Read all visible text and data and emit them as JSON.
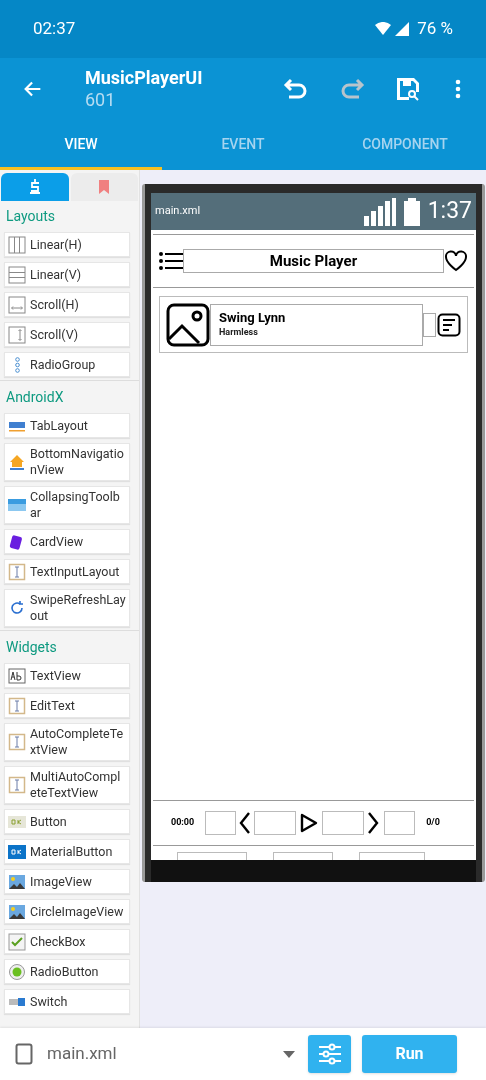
{
  "status_bar": {
    "time": "02:37",
    "battery": "76 %"
  },
  "app_bar": {
    "title": "MusicPlayerUI",
    "subtitle": "601",
    "redo_disabled": true
  },
  "tabs": [
    {
      "label": "VIEW",
      "selected": true
    },
    {
      "label": "EVENT",
      "selected": false
    },
    {
      "label": "COMPONENT",
      "selected": false
    }
  ],
  "palette_tabs": [
    {
      "selected": true
    },
    {
      "selected": false
    }
  ],
  "palette": [
    {
      "title": "Layouts",
      "items": [
        "Linear(H)",
        "Linear(V)",
        "Scroll(H)",
        "Scroll(V)",
        "RadioGroup"
      ]
    },
    {
      "title": "AndroidX",
      "items": [
        "TabLayout",
        "BottomNavigationView",
        "CollapsingToolbar",
        "CardView",
        "TextInputLayout",
        "SwipeRefreshLayout"
      ]
    },
    {
      "title": "Widgets",
      "items": [
        "TextView",
        "EditText",
        "AutoCompleteTextView",
        "MultiAutoCompleteTextView",
        "Button",
        "MaterialButton",
        "ImageView",
        "CircleImageView",
        "CheckBox",
        "RadioButton",
        "Switch"
      ]
    }
  ],
  "preview": {
    "file": "main.xml",
    "clock": "1:37",
    "toolbar_title": "Music Player",
    "song": {
      "title": "Swing Lynn",
      "artist": "Harmless"
    },
    "elapsed": "00:00",
    "count": "0/0"
  },
  "bottom_bar": {
    "file": "main.xml",
    "run": "Run"
  }
}
